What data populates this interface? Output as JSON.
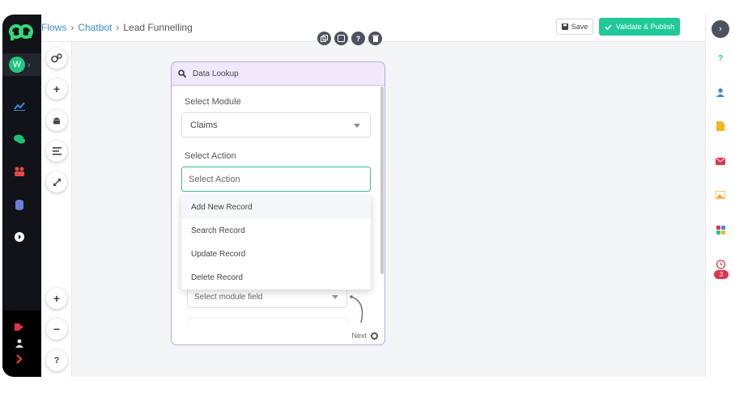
{
  "header": {
    "breadcrumb": [
      "Flows",
      "Chatbot",
      "Lead Funnelling"
    ],
    "save_label": "Save",
    "publish_label": "Validate & Publish"
  },
  "user": {
    "avatar_initial": "W"
  },
  "node": {
    "title": "Data Lookup",
    "module_label": "Select Module",
    "module_value": "Claims",
    "action_label": "Select Action",
    "action_placeholder": "Select Action",
    "field_placeholder": "Select module field",
    "next_label": "Next"
  },
  "dropdown": {
    "options": [
      "Add New Record",
      "Search Record",
      "Update Record",
      "Delete Record"
    ]
  },
  "right_rail": {
    "reminder_count": "3"
  },
  "tool_column": {
    "help_label": "?"
  },
  "colors": {
    "accent_green": "#20c997",
    "node_border": "#b8a9e6",
    "badge_red": "#e0334d",
    "link_blue": "#3a8bd8"
  },
  "icons": [
    "app-logo",
    "avatar",
    "analytics-icon",
    "chat-icon",
    "team-icon",
    "database-icon",
    "arrow-circle-icon",
    "logout-icon",
    "user-icon",
    "expand-icon",
    "settings-icon",
    "add-icon",
    "android-icon",
    "align-icon",
    "resize-icon",
    "zoom-in-icon",
    "zoom-out-icon",
    "help-icon",
    "copy-icon",
    "note-icon",
    "info-icon",
    "delete-icon",
    "search-icon",
    "question-icon",
    "contact-icon",
    "document-icon",
    "mail-icon",
    "image-icon",
    "apps-icon",
    "alarm-icon"
  ]
}
